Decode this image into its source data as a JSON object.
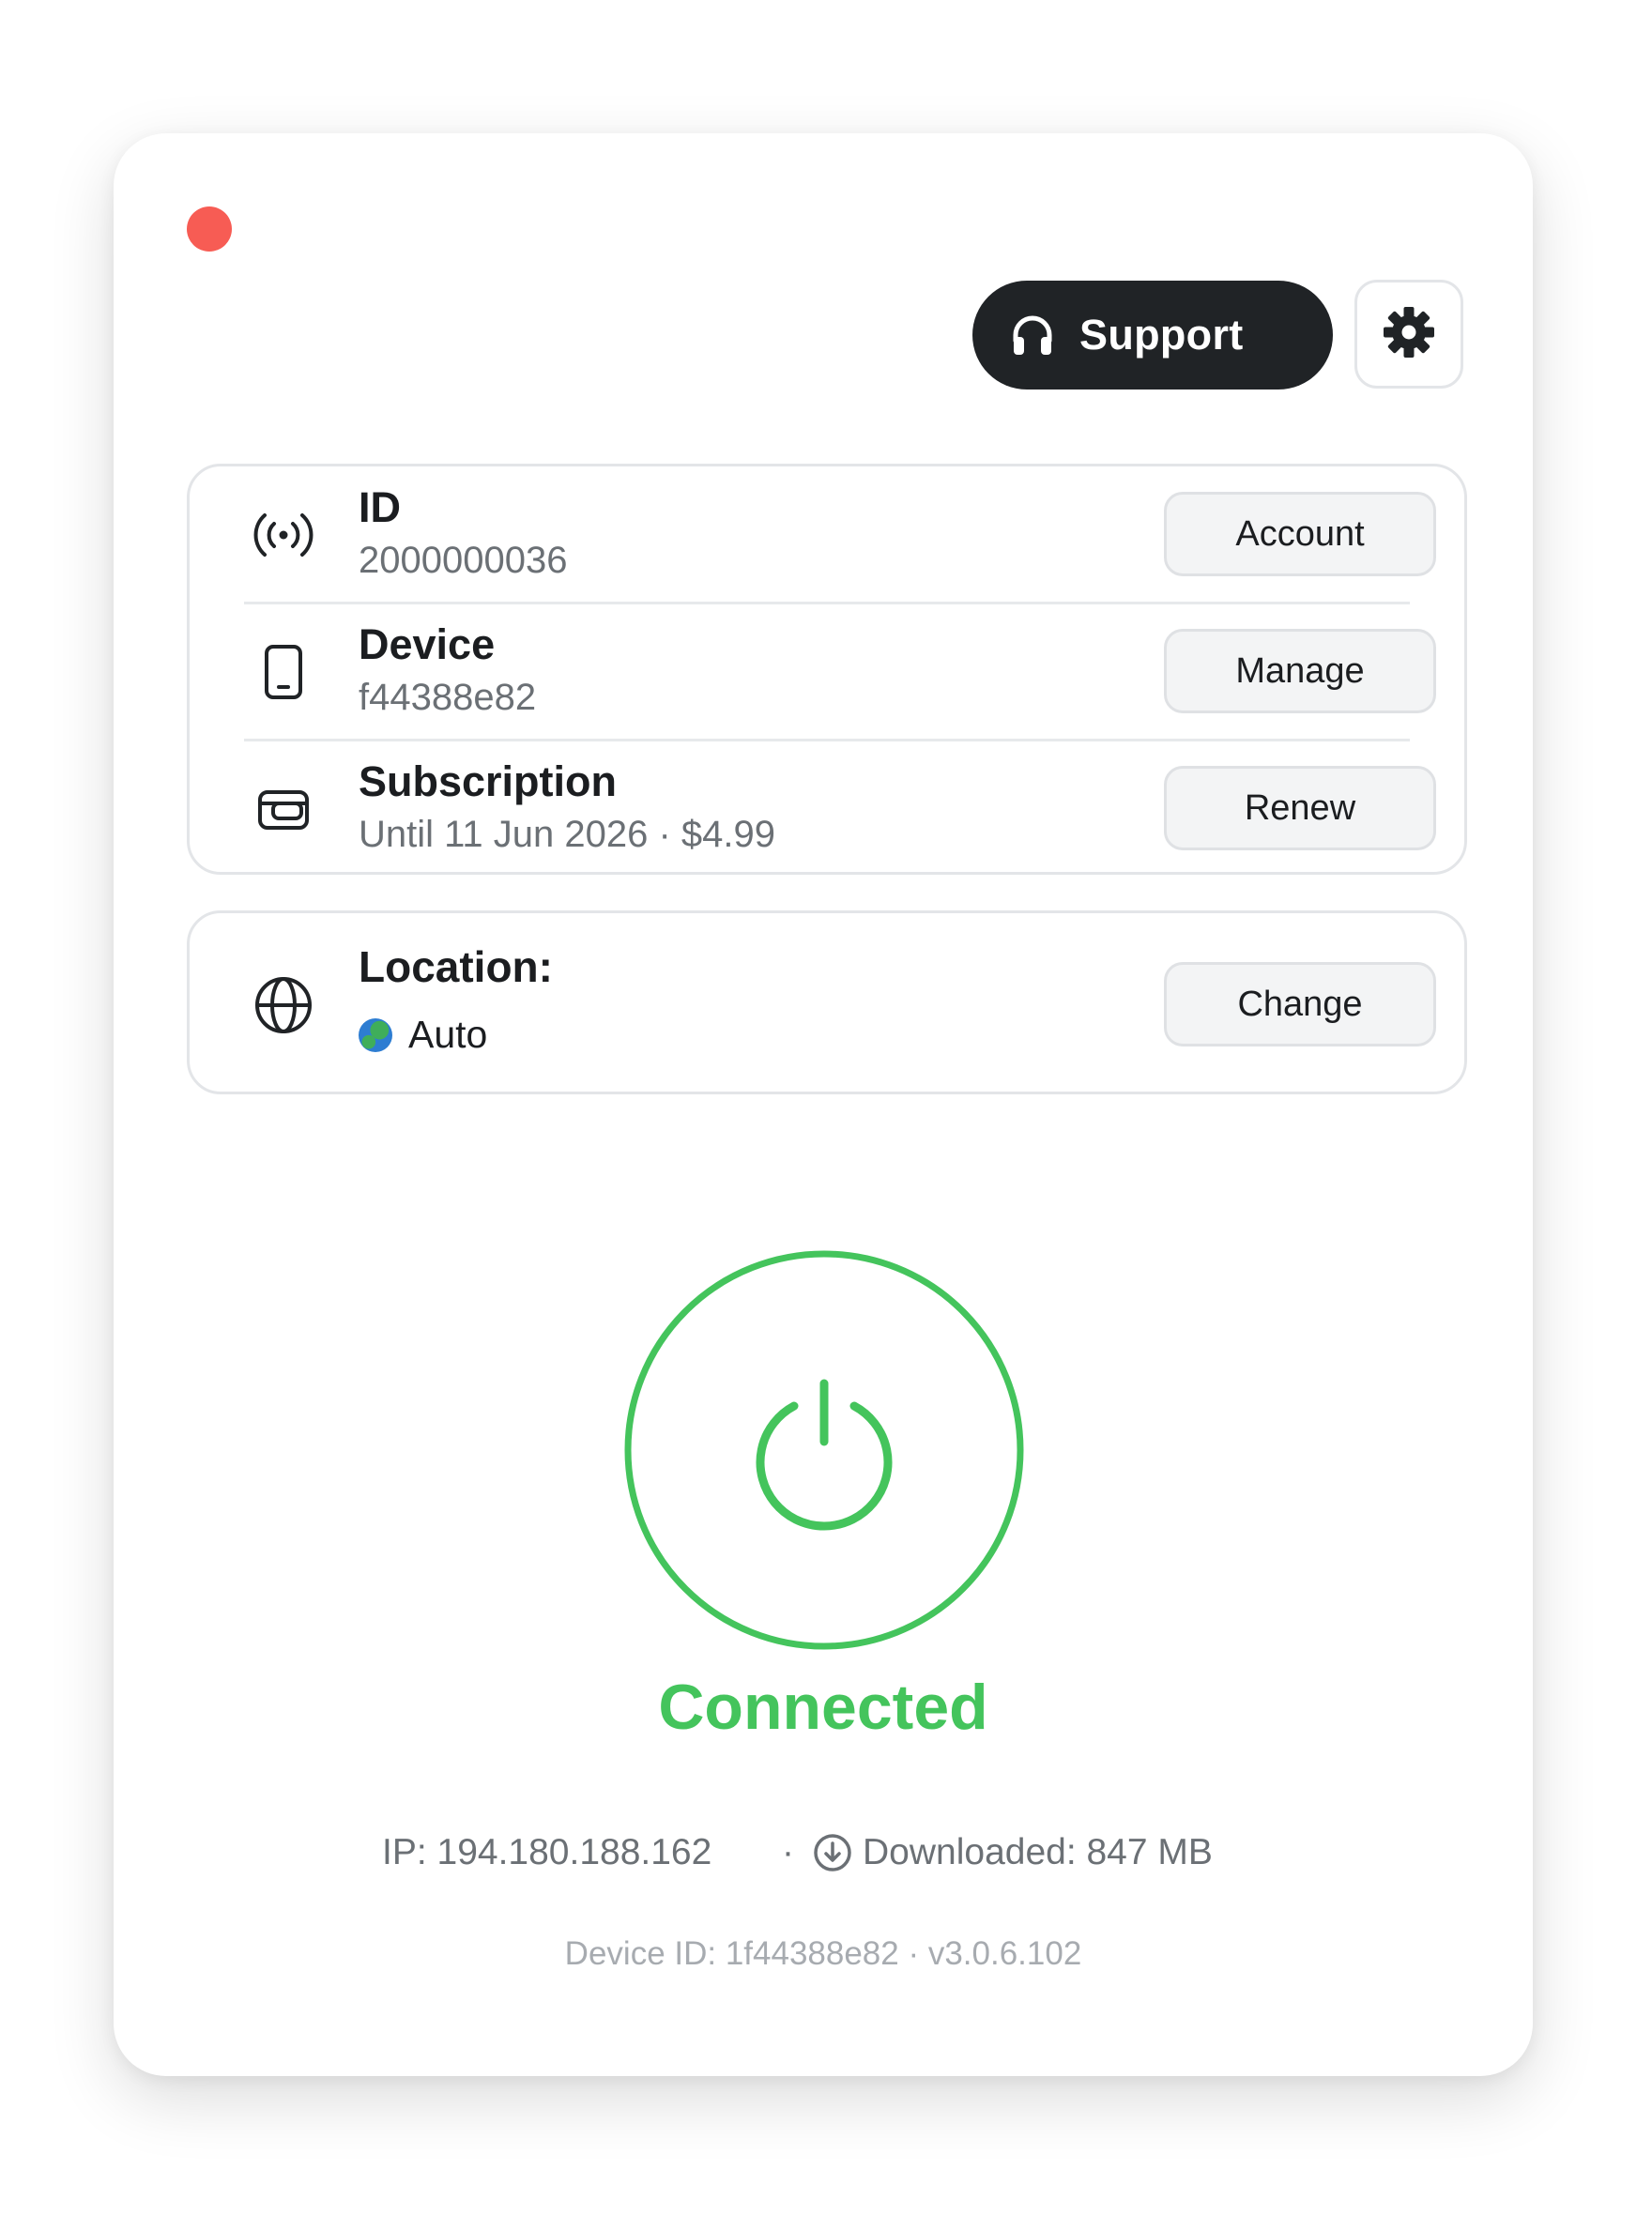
{
  "window": {
    "close_color": "#f75c54"
  },
  "header": {
    "support_label": "Support",
    "support_icon": "headphones-icon",
    "settings_icon": "gear-icon"
  },
  "info_card": {
    "rows": [
      {
        "title": "ID",
        "value": "2000000036",
        "action": "Account",
        "icon": "broadcast-icon"
      },
      {
        "title": "Device",
        "value": "f44388e82",
        "action": "Manage",
        "icon": "phone-icon"
      },
      {
        "title": "Subscription",
        "value": "Until 11 Jun 2026 · $4.99",
        "action": "Renew",
        "icon": "wallet-icon"
      }
    ]
  },
  "location": {
    "title": "Location:",
    "value": "Auto",
    "action": "Change",
    "icon": "globe-icon"
  },
  "connection": {
    "status": "Connected",
    "status_color": "#44c45c",
    "ip": "IP: 194.180.188.162",
    "separator": "·",
    "downloaded": "Downloaded: 847 MB"
  },
  "footer": {
    "text": "Device ID: 1f44388e82 · v3.0.6.102"
  }
}
